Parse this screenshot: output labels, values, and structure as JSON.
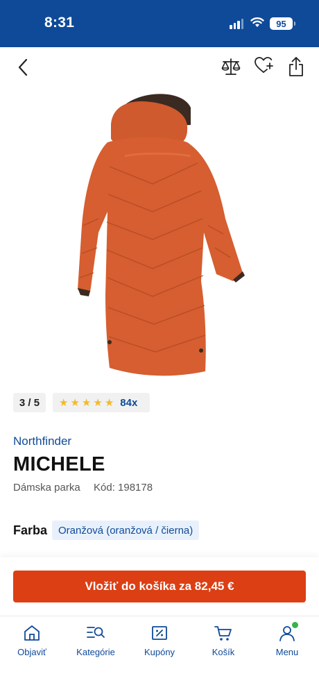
{
  "status_bar": {
    "time": "8:31",
    "battery": "95"
  },
  "product": {
    "image_counter": "3 / 5",
    "rating": 5,
    "review_count": "84x",
    "brand": "Northfinder",
    "name": "MICHELE",
    "category": "Dámska parka",
    "code": "Kód: 198178"
  },
  "color": {
    "label": "Farba",
    "value": "Oranžová (oranžová / čierna)"
  },
  "cart": {
    "button_label": "Vložiť do košíka za 82,45 €"
  },
  "bottom_nav": {
    "items": [
      {
        "label": "Objaviť",
        "icon": "home-icon"
      },
      {
        "label": "Kategórie",
        "icon": "categories-search-icon"
      },
      {
        "label": "Kupóny",
        "icon": "coupon-icon"
      },
      {
        "label": "Košík",
        "icon": "cart-icon"
      },
      {
        "label": "Menu",
        "icon": "user-icon"
      }
    ]
  },
  "colors": {
    "brand_blue": "#0f4a98",
    "cta_orange": "#dc3f14",
    "star": "#f3b92a",
    "status_dot": "#36b34a"
  }
}
